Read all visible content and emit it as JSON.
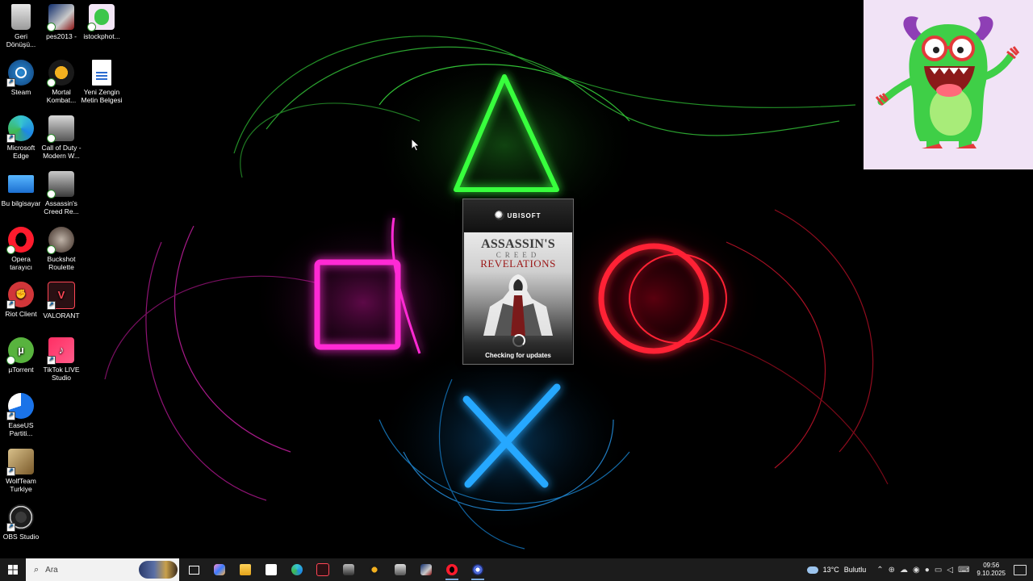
{
  "desktop": {
    "icons": [
      {
        "label": "Geri Dönüşü...",
        "icon": "recycle-bin-icon"
      },
      {
        "label": "pes2013 -",
        "icon": "pes2013-icon"
      },
      {
        "label": "istockphot...",
        "icon": "istockphoto-image-icon"
      },
      {
        "label": "Steam",
        "icon": "steam-icon"
      },
      {
        "label": "Mortal Kombat...",
        "icon": "mortal-kombat-icon"
      },
      {
        "label": "Yeni Zengin Metin Belgesi",
        "icon": "rich-text-document-icon"
      },
      {
        "label": "Microsoft Edge",
        "icon": "edge-icon"
      },
      {
        "label": "Call of Duty - Modern W...",
        "icon": "call-of-duty-icon"
      },
      {
        "label": "Bu bilgisayar",
        "icon": "this-pc-icon"
      },
      {
        "label": "Assassin's Creed Re...",
        "icon": "assassins-creed-icon"
      },
      {
        "label": "Opera tarayıcı",
        "icon": "opera-icon"
      },
      {
        "label": "Buckshot Roulette",
        "icon": "buckshot-roulette-icon"
      },
      {
        "label": "Riot Client",
        "icon": "riot-client-icon"
      },
      {
        "label": "VALORANT",
        "icon": "valorant-icon"
      },
      {
        "label": "µTorrent",
        "icon": "utorrent-icon"
      },
      {
        "label": "TikTok LIVE Studio",
        "icon": "tiktok-live-icon"
      },
      {
        "label": "EaseUS Partiti...",
        "icon": "easeus-icon"
      },
      {
        "label": "WolfTeam Turkiye",
        "icon": "wolfteam-icon"
      },
      {
        "label": "OBS Studio",
        "icon": "obs-icon"
      }
    ]
  },
  "splash": {
    "brand": "UBISOFT",
    "title_line1": "ASSASSIN'S",
    "title_line2": "CREED",
    "title_line3": "REVELATIONS",
    "status": "Checking for updates"
  },
  "taskbar": {
    "search_placeholder": "Ara",
    "apps": [
      "task-view-icon",
      "copilot-icon",
      "file-explorer-icon",
      "microsoft-store-icon",
      "edge-icon",
      "valorant-icon",
      "assassins-creed-icon",
      "mortal-kombat-icon",
      "call-of-duty-icon",
      "pes2013-icon",
      "opera-icon",
      "ubisoft-connect-icon"
    ],
    "weather_temp": "13°C",
    "weather_desc": "Bulutlu",
    "time": "09:56",
    "date": "9.10.2025"
  },
  "colors": {
    "taskbar_bg": "#1c1c1c",
    "triangle": "#39ff3c",
    "square": "#ff2ad4",
    "circle": "#ff2035",
    "cross": "#25a8ff"
  }
}
